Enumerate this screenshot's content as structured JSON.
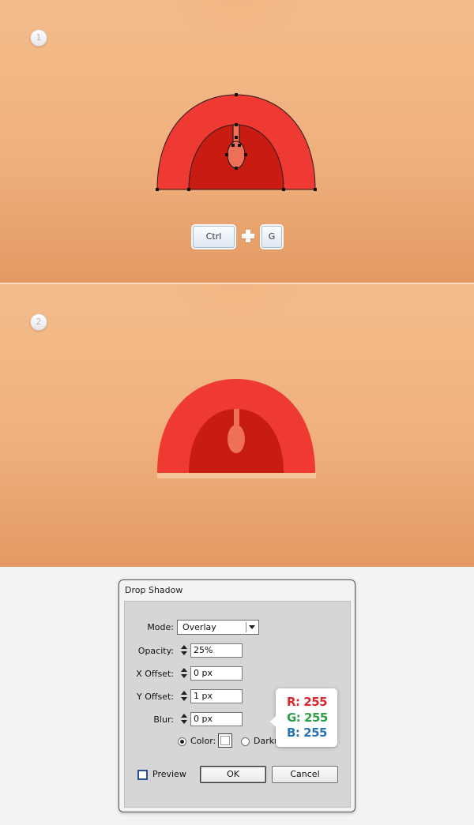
{
  "steps": [
    {
      "number": "1"
    },
    {
      "number": "2"
    }
  ],
  "shortcut": {
    "key1": "Ctrl",
    "key2": "G"
  },
  "colors": {
    "arch_outer": "#ee3a32",
    "arch_inner": "#c81b12",
    "keyhole": "#ef7058",
    "base_strip": "#f4c599",
    "r_text": "#d9282f",
    "g_text": "#2f9c49",
    "b_text": "#2774b5"
  },
  "dialog": {
    "title": "Drop Shadow",
    "mode_label": "Mode:",
    "mode_value": "Overlay",
    "opacity_label": "Opacity:",
    "opacity_value": "25%",
    "x_offset_label": "X Offset:",
    "x_offset_value": "0 px",
    "y_offset_label": "Y Offset:",
    "y_offset_value": "1 px",
    "blur_label": "Blur:",
    "blur_value": "0 px",
    "color_label": "Color:",
    "darkness_label": "Darkn",
    "preview_label": "Preview",
    "ok_label": "OK",
    "cancel_label": "Cancel"
  },
  "color_tooltip": {
    "r": "R: 255",
    "g": "G: 255",
    "b": "B: 255"
  }
}
